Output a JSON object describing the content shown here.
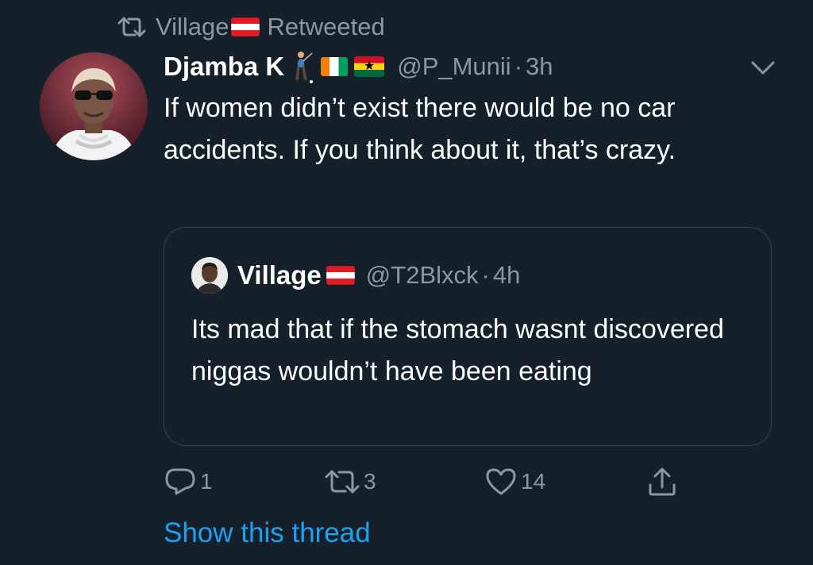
{
  "retweet_context": {
    "label": "Retweeted",
    "retweeter_name": "Village",
    "icons": [
      "retweet-icon",
      "austria-flag-icon"
    ]
  },
  "tweet": {
    "display_name": "Djamba K",
    "name_icons": [
      "golfer-icon",
      "ivory-coast-flag-icon",
      "ghana-flag-icon"
    ],
    "handle": "@P_Munii",
    "separator": "·",
    "time": "3h",
    "text": "If women didn’t exist there would be no car accidents. If you think about it, that’s crazy."
  },
  "quoted_tweet": {
    "display_name": "Village",
    "handle": "@T2Blxck",
    "separator": "·",
    "time": "4h",
    "text": "Its mad that if the stomach wasnt discovered niggas wouldn’t have been eating"
  },
  "actions": {
    "reply_count": "1",
    "retweet_count": "3",
    "like_count": "14"
  },
  "show_thread_label": "Show this thread",
  "colors": {
    "background": "#15202b",
    "text_primary": "#ffffff",
    "text_secondary": "#8899a6",
    "link": "#1da1f2",
    "border": "#38444d"
  }
}
